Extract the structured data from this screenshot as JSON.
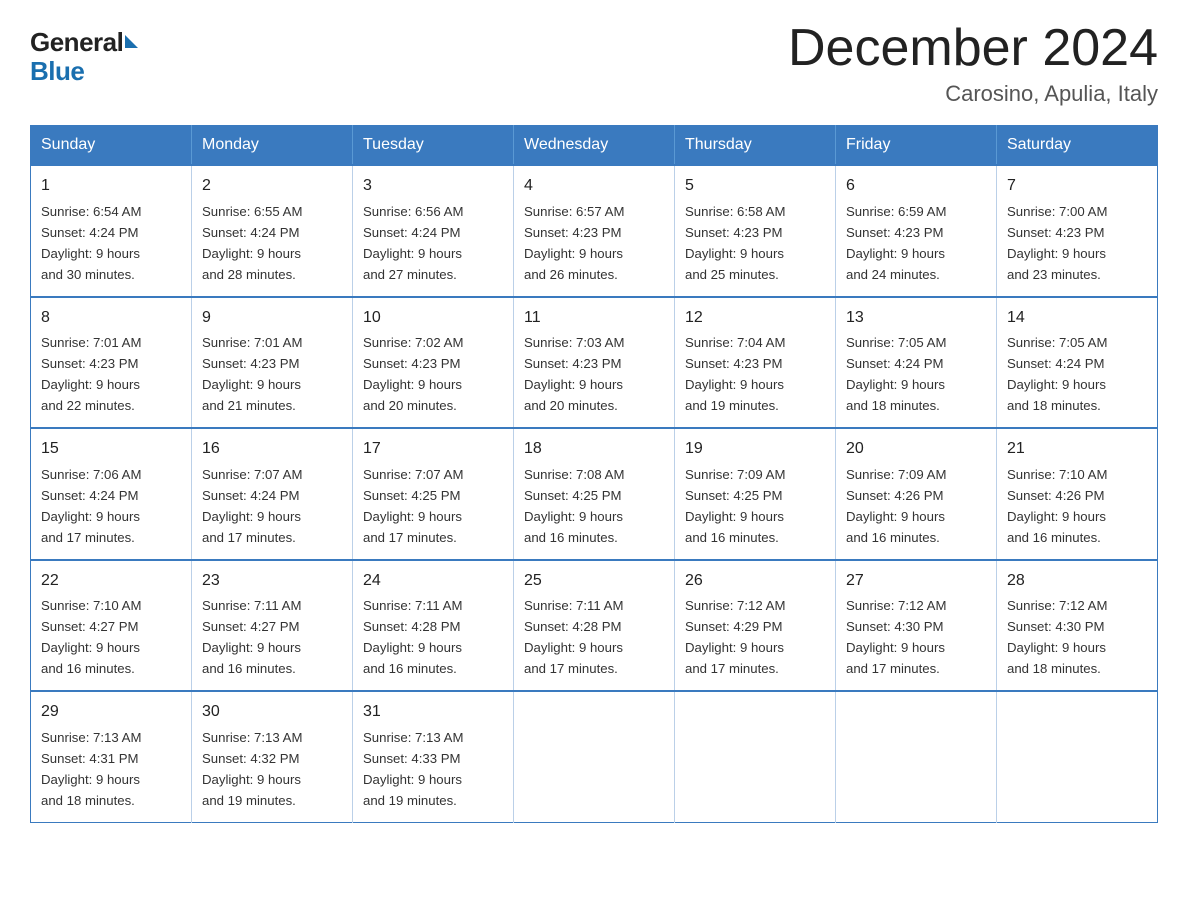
{
  "logo": {
    "general": "General",
    "blue": "Blue"
  },
  "title": "December 2024",
  "subtitle": "Carosino, Apulia, Italy",
  "weekdays": [
    "Sunday",
    "Monday",
    "Tuesday",
    "Wednesday",
    "Thursday",
    "Friday",
    "Saturday"
  ],
  "weeks": [
    [
      {
        "day": "1",
        "sunrise": "6:54 AM",
        "sunset": "4:24 PM",
        "daylight": "9 hours and 30 minutes."
      },
      {
        "day": "2",
        "sunrise": "6:55 AM",
        "sunset": "4:24 PM",
        "daylight": "9 hours and 28 minutes."
      },
      {
        "day": "3",
        "sunrise": "6:56 AM",
        "sunset": "4:24 PM",
        "daylight": "9 hours and 27 minutes."
      },
      {
        "day": "4",
        "sunrise": "6:57 AM",
        "sunset": "4:23 PM",
        "daylight": "9 hours and 26 minutes."
      },
      {
        "day": "5",
        "sunrise": "6:58 AM",
        "sunset": "4:23 PM",
        "daylight": "9 hours and 25 minutes."
      },
      {
        "day": "6",
        "sunrise": "6:59 AM",
        "sunset": "4:23 PM",
        "daylight": "9 hours and 24 minutes."
      },
      {
        "day": "7",
        "sunrise": "7:00 AM",
        "sunset": "4:23 PM",
        "daylight": "9 hours and 23 minutes."
      }
    ],
    [
      {
        "day": "8",
        "sunrise": "7:01 AM",
        "sunset": "4:23 PM",
        "daylight": "9 hours and 22 minutes."
      },
      {
        "day": "9",
        "sunrise": "7:01 AM",
        "sunset": "4:23 PM",
        "daylight": "9 hours and 21 minutes."
      },
      {
        "day": "10",
        "sunrise": "7:02 AM",
        "sunset": "4:23 PM",
        "daylight": "9 hours and 20 minutes."
      },
      {
        "day": "11",
        "sunrise": "7:03 AM",
        "sunset": "4:23 PM",
        "daylight": "9 hours and 20 minutes."
      },
      {
        "day": "12",
        "sunrise": "7:04 AM",
        "sunset": "4:23 PM",
        "daylight": "9 hours and 19 minutes."
      },
      {
        "day": "13",
        "sunrise": "7:05 AM",
        "sunset": "4:24 PM",
        "daylight": "9 hours and 18 minutes."
      },
      {
        "day": "14",
        "sunrise": "7:05 AM",
        "sunset": "4:24 PM",
        "daylight": "9 hours and 18 minutes."
      }
    ],
    [
      {
        "day": "15",
        "sunrise": "7:06 AM",
        "sunset": "4:24 PM",
        "daylight": "9 hours and 17 minutes."
      },
      {
        "day": "16",
        "sunrise": "7:07 AM",
        "sunset": "4:24 PM",
        "daylight": "9 hours and 17 minutes."
      },
      {
        "day": "17",
        "sunrise": "7:07 AM",
        "sunset": "4:25 PM",
        "daylight": "9 hours and 17 minutes."
      },
      {
        "day": "18",
        "sunrise": "7:08 AM",
        "sunset": "4:25 PM",
        "daylight": "9 hours and 16 minutes."
      },
      {
        "day": "19",
        "sunrise": "7:09 AM",
        "sunset": "4:25 PM",
        "daylight": "9 hours and 16 minutes."
      },
      {
        "day": "20",
        "sunrise": "7:09 AM",
        "sunset": "4:26 PM",
        "daylight": "9 hours and 16 minutes."
      },
      {
        "day": "21",
        "sunrise": "7:10 AM",
        "sunset": "4:26 PM",
        "daylight": "9 hours and 16 minutes."
      }
    ],
    [
      {
        "day": "22",
        "sunrise": "7:10 AM",
        "sunset": "4:27 PM",
        "daylight": "9 hours and 16 minutes."
      },
      {
        "day": "23",
        "sunrise": "7:11 AM",
        "sunset": "4:27 PM",
        "daylight": "9 hours and 16 minutes."
      },
      {
        "day": "24",
        "sunrise": "7:11 AM",
        "sunset": "4:28 PM",
        "daylight": "9 hours and 16 minutes."
      },
      {
        "day": "25",
        "sunrise": "7:11 AM",
        "sunset": "4:28 PM",
        "daylight": "9 hours and 17 minutes."
      },
      {
        "day": "26",
        "sunrise": "7:12 AM",
        "sunset": "4:29 PM",
        "daylight": "9 hours and 17 minutes."
      },
      {
        "day": "27",
        "sunrise": "7:12 AM",
        "sunset": "4:30 PM",
        "daylight": "9 hours and 17 minutes."
      },
      {
        "day": "28",
        "sunrise": "7:12 AM",
        "sunset": "4:30 PM",
        "daylight": "9 hours and 18 minutes."
      }
    ],
    [
      {
        "day": "29",
        "sunrise": "7:13 AM",
        "sunset": "4:31 PM",
        "daylight": "9 hours and 18 minutes."
      },
      {
        "day": "30",
        "sunrise": "7:13 AM",
        "sunset": "4:32 PM",
        "daylight": "9 hours and 19 minutes."
      },
      {
        "day": "31",
        "sunrise": "7:13 AM",
        "sunset": "4:33 PM",
        "daylight": "9 hours and 19 minutes."
      },
      null,
      null,
      null,
      null
    ]
  ]
}
